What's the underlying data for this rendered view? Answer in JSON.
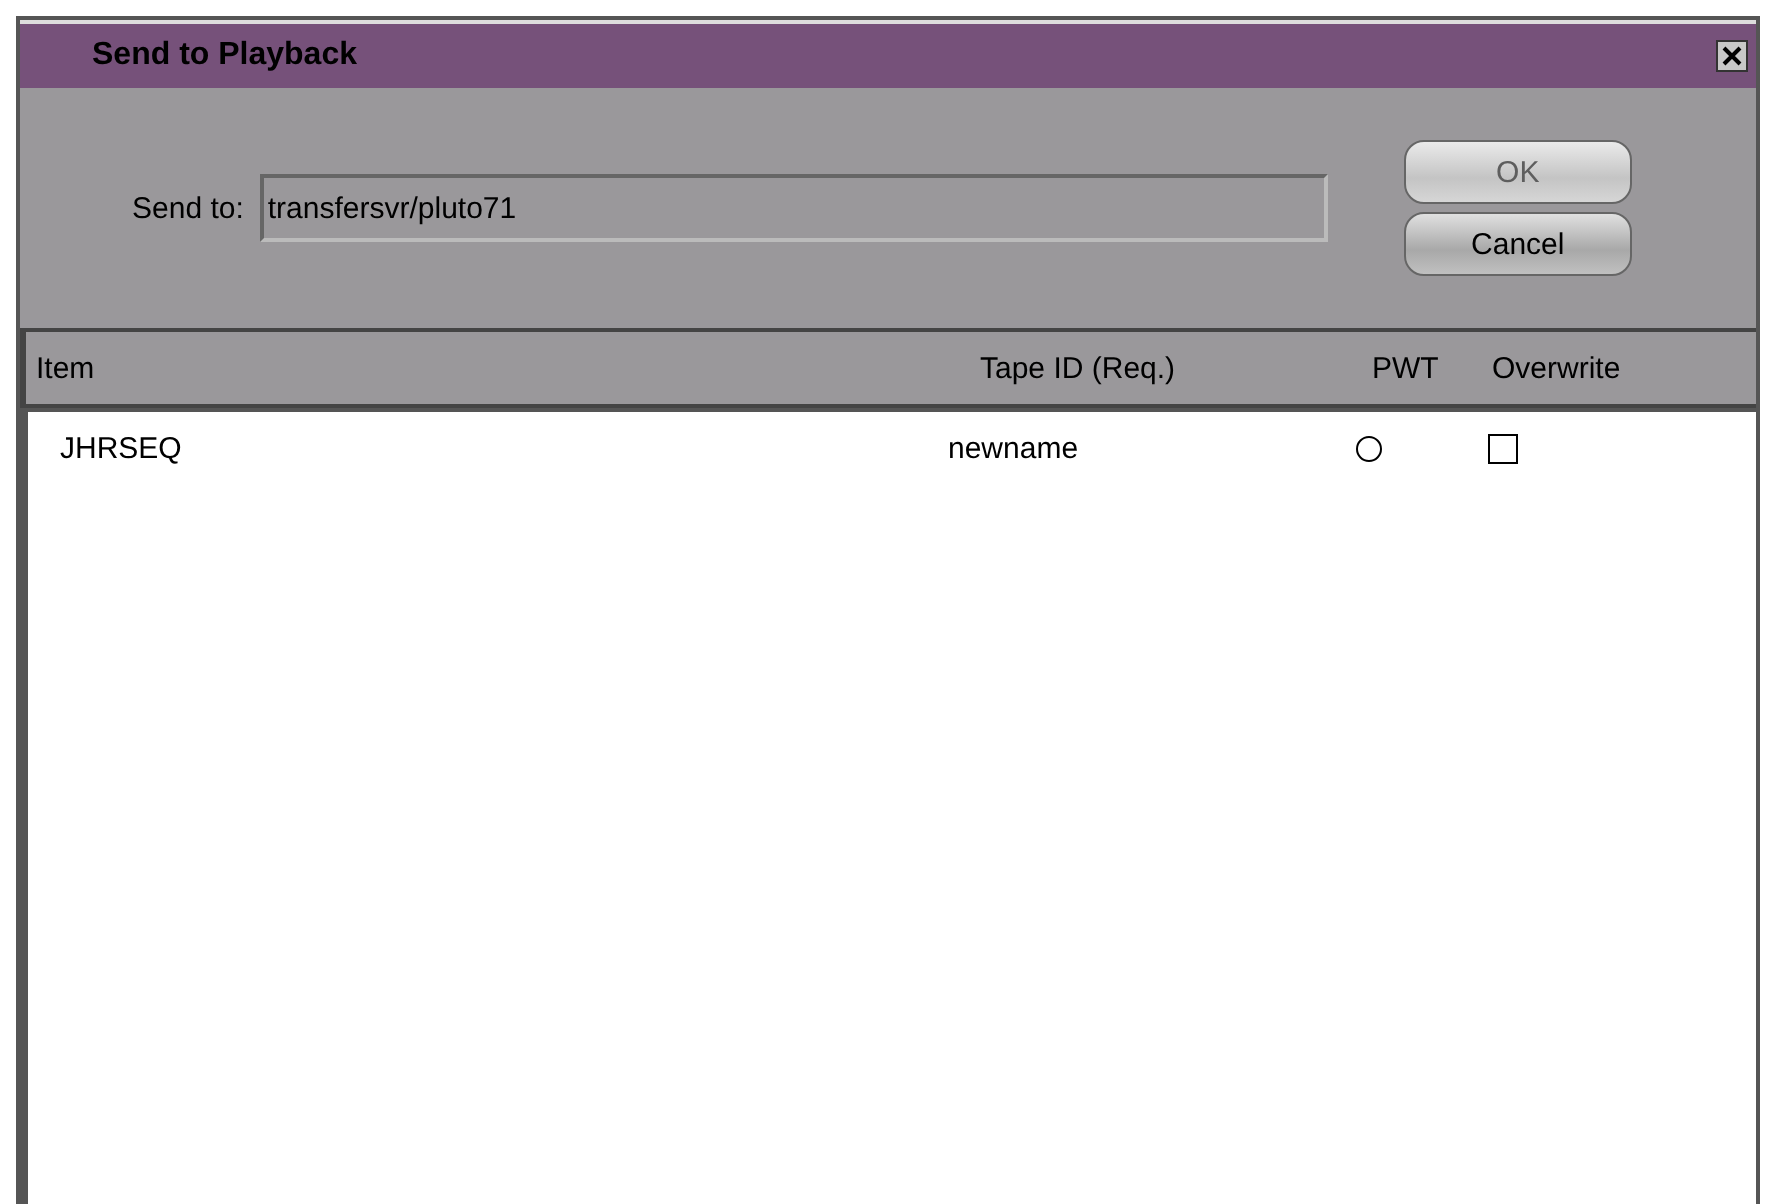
{
  "window": {
    "title": "Send to Playback"
  },
  "send_to": {
    "label": "Send to:",
    "value": "transfersvr/pluto71"
  },
  "buttons": [
    {
      "label": "OK",
      "disabled": true
    },
    {
      "label": "Cancel",
      "disabled": false
    }
  ],
  "table": {
    "columns": [
      "Item",
      "Tape ID (Req.)",
      "PWT",
      "Overwrite"
    ],
    "rows": [
      {
        "item": "JHRSEQ",
        "tape_id": "newname",
        "pwt": false,
        "overwrite": false
      }
    ]
  }
}
